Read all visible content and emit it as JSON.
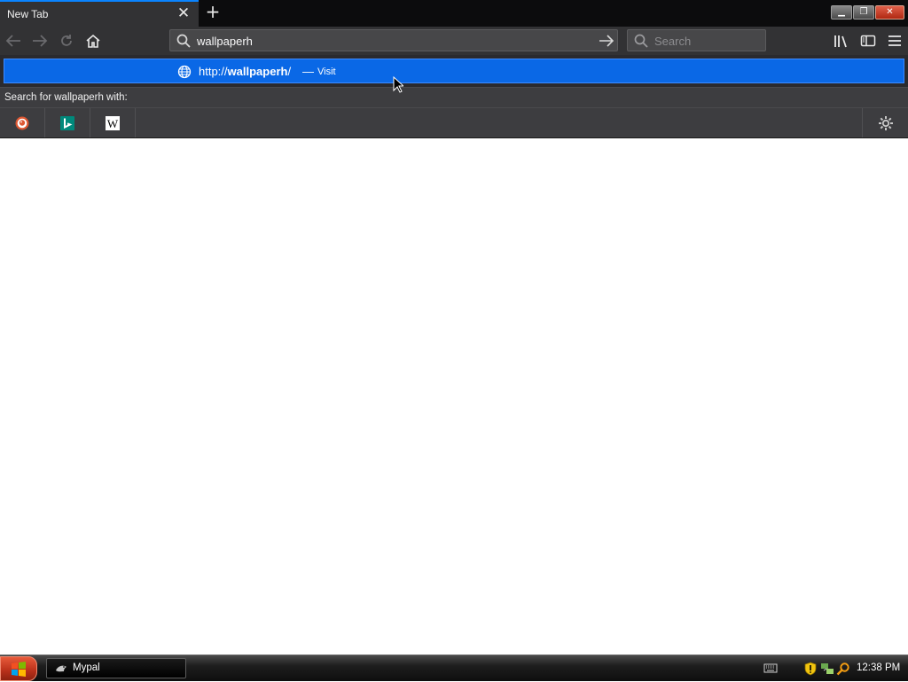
{
  "tabs": [
    {
      "title": "New Tab",
      "active": true
    }
  ],
  "toolbar": {
    "url_value": "wallpaperh",
    "search_placeholder": "Search",
    "accent_color": "#0a84ff"
  },
  "dropdown": {
    "result": {
      "prefix": "http://",
      "host_bold": "wallpaperh",
      "suffix": "/",
      "dash": "—",
      "action": "Visit",
      "icon": "globe-icon"
    },
    "search_with_label": "Search for wallpaperh with:",
    "engines": [
      {
        "name": "duckduckgo",
        "icon": "duckduckgo-icon"
      },
      {
        "name": "bing",
        "icon": "bing-icon"
      },
      {
        "name": "wikipedia",
        "icon": "wikipedia-icon"
      }
    ]
  },
  "taskbar": {
    "tasks": [
      {
        "label": "Mypal",
        "icon": "mypal-icon"
      }
    ],
    "clock": "12:38 PM"
  }
}
